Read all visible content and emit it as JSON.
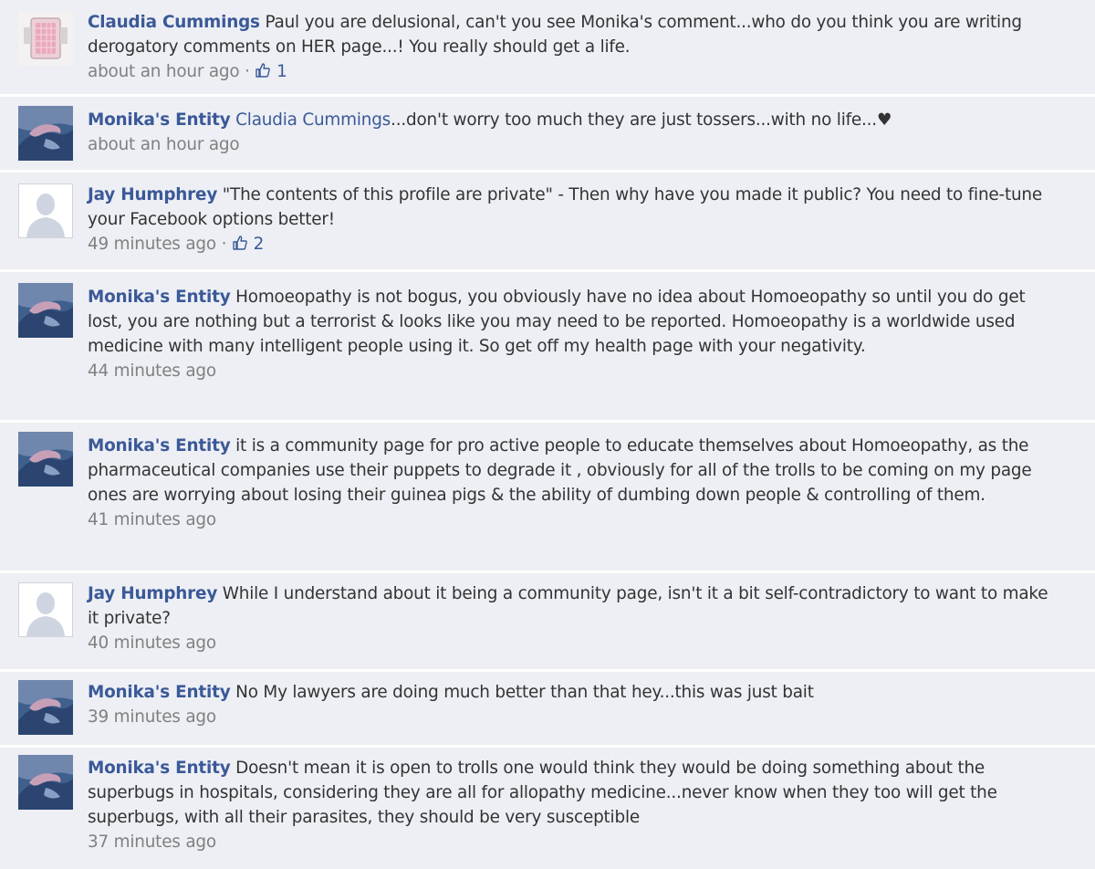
{
  "comments": [
    {
      "author": "Claudia Cummings",
      "avatar": "ring-photo",
      "mention": "",
      "text": "Paul you are delusional, can't you see Monika's comment...who do you think you are writing derogatory comments on HER page...! You really should get a life.",
      "time": "about an hour ago",
      "separator": "·",
      "likes": "1"
    },
    {
      "author": "Monika's Entity",
      "avatar": "blue-figure-photo",
      "mention": "Claudia Cummings",
      "text": "...don't worry too much they are just tossers...with no life...♥",
      "time": "about an hour ago",
      "separator": "",
      "likes": ""
    },
    {
      "author": "Jay Humphrey",
      "avatar": "default-silhouette",
      "mention": "",
      "text": "\"The contents of this profile are private\" - Then why have you made it public? You need to fine-tune your Facebook options better!",
      "time": "49 minutes ago",
      "separator": "·",
      "likes": "2"
    },
    {
      "author": "Monika's Entity",
      "avatar": "blue-figure-photo",
      "mention": "",
      "text": "Homoeopathy is not bogus, you obviously have no idea about Homoeopathy so until you do get lost, you are nothing but a terrorist & looks like you may need to be reported. Homoeopathy is a worldwide used medicine with many intelligent people using it. So get off my health page with your negativity.",
      "time": "44 minutes ago",
      "separator": "",
      "likes": ""
    },
    {
      "author": "Monika's Entity",
      "avatar": "blue-figure-photo",
      "mention": "",
      "text": "it is a community page for pro active people to educate themselves about Homoeopathy, as the pharmaceutical companies use their puppets to degrade it , obviously for all of the trolls to be coming on my page ones are worrying about losing their guinea pigs & the ability of dumbing down people & controlling of them.",
      "time": "41 minutes ago",
      "separator": "",
      "likes": ""
    },
    {
      "author": "Jay Humphrey",
      "avatar": "default-silhouette",
      "mention": "",
      "text": "While I understand about it being a community page, isn't it a bit self-contradictory to want to make it private?",
      "time": "40 minutes ago",
      "separator": "",
      "likes": ""
    },
    {
      "author": "Monika's Entity",
      "avatar": "blue-figure-photo",
      "mention": "",
      "text": "No My lawyers are doing much better than that hey...this was just bait",
      "time": "39 minutes ago",
      "separator": "",
      "likes": ""
    },
    {
      "author": "Monika's Entity",
      "avatar": "blue-figure-photo",
      "mention": "",
      "text": "Doesn't mean it is open to trolls one would think they would be doing something about the superbugs in hospitals, considering they are all for allopathy medicine...never know when they too will get the superbugs, with all their parasites, they should be very susceptible",
      "time": "37 minutes ago",
      "separator": "",
      "likes": ""
    }
  ],
  "colors": {
    "background": "#edeff4",
    "divider": "#ffffff",
    "link": "#3b5998",
    "text": "#333333",
    "meta": "#808080"
  }
}
